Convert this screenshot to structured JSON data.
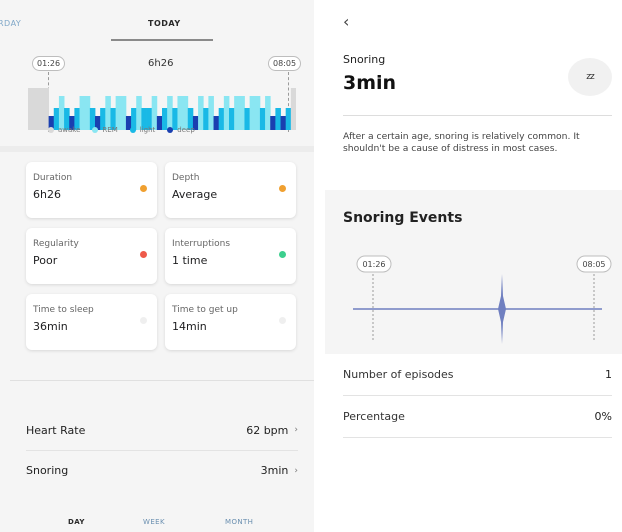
{
  "left": {
    "tabs": {
      "previous": "RDAY",
      "current": "TODAY"
    },
    "graph": {
      "start_time": "01:26",
      "end_time": "08:05",
      "duration": "6h26",
      "colors": {
        "awake": "#d9d9d9",
        "rem": "#8ae6f2",
        "light": "#19b9e6",
        "deep": "#1a3fb0"
      }
    },
    "legend": [
      {
        "label": "awake",
        "color": "#d9d9d9"
      },
      {
        "label": "REM",
        "color": "#8ae6f2"
      },
      {
        "label": "light",
        "color": "#19b9e6"
      },
      {
        "label": "deep",
        "color": "#1a3fb0"
      }
    ],
    "metrics": [
      {
        "label": "Duration",
        "value": "6h26",
        "status_color": "#f0a030"
      },
      {
        "label": "Depth",
        "value": "Average",
        "status_color": "#f0a030"
      },
      {
        "label": "Regularity",
        "value": "Poor",
        "status_color": "#ee5a4a"
      },
      {
        "label": "Interruptions",
        "value": "1 time",
        "status_color": "#3ccf8e"
      },
      {
        "label": "Time to sleep",
        "value": "36min",
        "status_color": "#efefef"
      },
      {
        "label": "Time to get up",
        "value": "14min",
        "status_color": "#efefef"
      }
    ],
    "list": [
      {
        "label": "Heart Rate",
        "value": "62 bpm",
        "chevron": "›"
      },
      {
        "label": "Snoring",
        "value": "3min",
        "chevron": "›"
      }
    ],
    "bottom_tabs": {
      "day": "DAY",
      "week": "WEEK",
      "month": "MONTH"
    }
  },
  "right": {
    "back_icon": "‹",
    "title": "Snoring",
    "value": "3min",
    "zz_icon": "zz",
    "description": "After a certain age, snoring is relatively common. It shouldn't be a cause of distress in most cases.",
    "events": {
      "title": "Snoring Events",
      "start_time": "01:26",
      "end_time": "08:05",
      "line_color": "#6f7fc0"
    },
    "stats": [
      {
        "label": "Number of episodes",
        "value": "1"
      },
      {
        "label": "Percentage",
        "value": "0%"
      }
    ]
  }
}
